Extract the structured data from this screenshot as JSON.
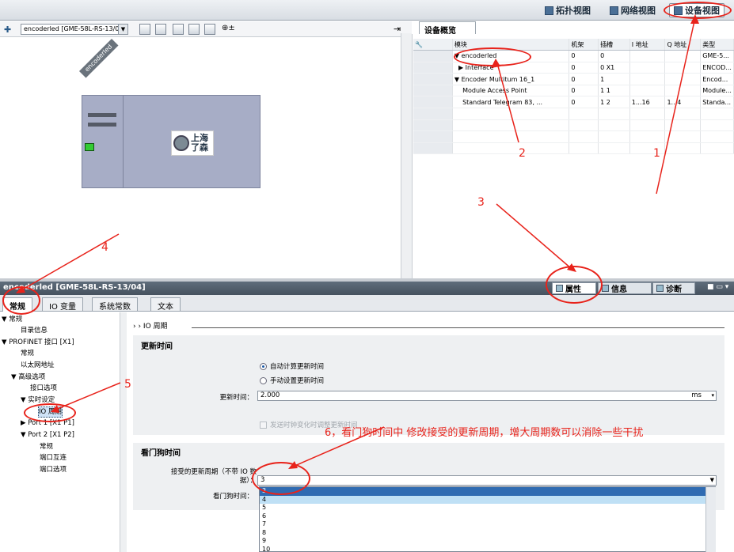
{
  "top_tabs": [
    {
      "label": "拓扑视图",
      "active": false
    },
    {
      "label": "网络视图",
      "active": false
    },
    {
      "label": "设备视图",
      "active": true
    }
  ],
  "device_select": {
    "value": "encoderled [GME-58L-RS-13/0"
  },
  "device": {
    "label": "encoderled",
    "logo_text": [
      "上海",
      "了森"
    ]
  },
  "overview": {
    "tab": "设备概览",
    "columns": [
      "",
      "模块",
      "机架",
      "插槽",
      "I 地址",
      "Q 地址",
      "类型"
    ],
    "rows": [
      {
        "module": "▼ encoderled",
        "rack": "0",
        "slot": "0",
        "i": "",
        "q": "",
        "type": "GME-5..."
      },
      {
        "module": "  ▶ Interface",
        "rack": "0",
        "slot": "0 X1",
        "i": "",
        "q": "",
        "type": "ENCOD..."
      },
      {
        "module": "▼ Encoder Multitum 16_1",
        "rack": "0",
        "slot": "1",
        "i": "",
        "q": "",
        "type": "Encod..."
      },
      {
        "module": "    Module Access Point",
        "rack": "0",
        "slot": "1 1",
        "i": "",
        "q": "",
        "type": "Module..."
      },
      {
        "module": "    Standard Telegram 83, ...",
        "rack": "0",
        "slot": "1 2",
        "i": "1...16",
        "q": "1...4",
        "type": "Standa..."
      }
    ]
  },
  "inspector": {
    "title": "encoderled [GME-58L-RS-13/04]",
    "tabs": [
      {
        "label": "属性",
        "active": true
      },
      {
        "label": "信息",
        "active": false
      },
      {
        "label": "诊断",
        "active": false
      }
    ]
  },
  "prop_tabs": [
    "常规",
    "IO 变量",
    "系统常数",
    "文本"
  ],
  "nav": [
    {
      "label": "▼ 常规",
      "indent": 0
    },
    {
      "label": "目录信息",
      "indent": 2
    },
    {
      "label": "▼ PROFINET 接口 [X1]",
      "indent": 0
    },
    {
      "label": "常规",
      "indent": 2
    },
    {
      "label": "以太网地址",
      "indent": 2
    },
    {
      "label": "▼ 高级选项",
      "indent": 2
    },
    {
      "label": "接口选项",
      "indent": 3
    },
    {
      "label": "▼ 实时设定",
      "indent": 3
    },
    {
      "label": "IO 周期",
      "indent": 4,
      "selected": true
    },
    {
      "label": "▶ Port 1 [X1 P1]",
      "indent": 3
    },
    {
      "label": "▼ Port 2 [X1 P2]",
      "indent": 3
    },
    {
      "label": "常规",
      "indent": 4
    },
    {
      "label": "端口互连",
      "indent": 4
    },
    {
      "label": "端口选项",
      "indent": 4
    }
  ],
  "breadcrumb": "› ›  IO 周期",
  "update_time": {
    "header": "更新时间",
    "radio1": "自动计算更新时间",
    "radio2": "手动设置更新时间",
    "field_label": "更新时间：",
    "value": "2.000",
    "unit": "ms",
    "checkbox": "发送时钟变化时调整更新时间"
  },
  "watchdog": {
    "header": "看门狗时间",
    "accepted_label": "接受的更新周期（不带 IO 数据）：",
    "accepted_value": "3",
    "watchdog_label": "看门狗时间：",
    "options": [
      "3",
      "4",
      "5",
      "6",
      "7",
      "8",
      "9",
      "10"
    ]
  },
  "annotations": {
    "n1": "1",
    "n2": "2",
    "n3": "3",
    "n4": "4",
    "n5": "5",
    "n6": "6，看门狗时间中 修改接受的更新周期，增大周期数可以消除一些干扰"
  }
}
